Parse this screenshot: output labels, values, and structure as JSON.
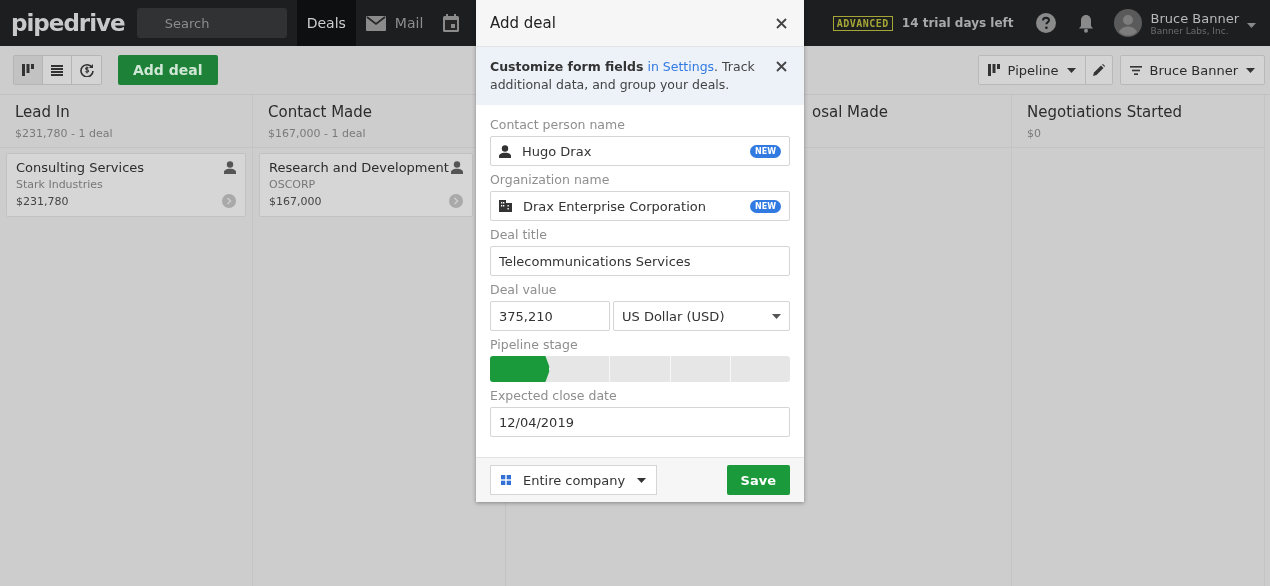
{
  "navbar": {
    "logo": "pipedrive",
    "search": {
      "placeholder": "Search"
    },
    "tabs": [
      {
        "kind": "deals",
        "label": "Deals",
        "selected": true
      },
      {
        "kind": "mail",
        "label": "Mail",
        "selected": false
      },
      {
        "kind": "calendar",
        "selected": false
      }
    ],
    "plan_badge": "ADVANCED",
    "trial": "14 trial days left",
    "user": {
      "name": "Bruce Banner",
      "company": "Banner Labs, Inc."
    }
  },
  "toolbar": {
    "views": [
      {
        "kind": "pipeline",
        "selected": true
      },
      {
        "kind": "list",
        "selected": false
      },
      {
        "kind": "forecast",
        "selected": false
      }
    ],
    "add_button": "Add deal",
    "pipeline_menu": "Pipeline",
    "filter_menu": "Bruce Banner"
  },
  "stages": [
    {
      "kind": "full",
      "title": "Lead In",
      "summary": "$231,780 - 1 deal",
      "deals": [
        {
          "title": "Consulting Services",
          "organization": "Stark Industries",
          "value": "$231,780"
        }
      ]
    },
    {
      "kind": "full",
      "title": "Contact Made",
      "summary": "$167,000 - 1 deal",
      "deals": [
        {
          "title": "Research and Development",
          "organization": "OSCORP",
          "value": "$167,000"
        }
      ]
    },
    {
      "kind": "covered",
      "title": "osal Made"
    },
    {
      "kind": "full",
      "title": "Negotiations Started",
      "summary": "$0"
    }
  ],
  "modal": {
    "title": "Add deal",
    "notice": {
      "text": "Customize form fields",
      "link": "in Settings",
      "rest": ". Track additional data, and group your deals."
    },
    "fields": [
      {
        "kind": "contact",
        "label": "Contact person name",
        "value": "Hugo Drax",
        "badge": "NEW"
      },
      {
        "kind": "organization",
        "label": "Organization name",
        "value": "Drax Enterprise Corporation",
        "badge": "NEW"
      },
      {
        "kind": "text",
        "label": "Deal title",
        "value": "Telecommunications Services"
      },
      {
        "kind": "money",
        "label": "Deal value",
        "value": "375,210",
        "currency": "US Dollar (USD)"
      },
      {
        "kind": "stages",
        "label": "Pipeline stage",
        "stages": [
          {
            "selected": true
          },
          {
            "selected": false
          },
          {
            "selected": false
          },
          {
            "selected": false
          },
          {
            "selected": false
          }
        ]
      },
      {
        "kind": "text",
        "label": "Expected close date",
        "value": "12/04/2019"
      }
    ],
    "visibility": "Entire company",
    "save_button": "Save"
  }
}
